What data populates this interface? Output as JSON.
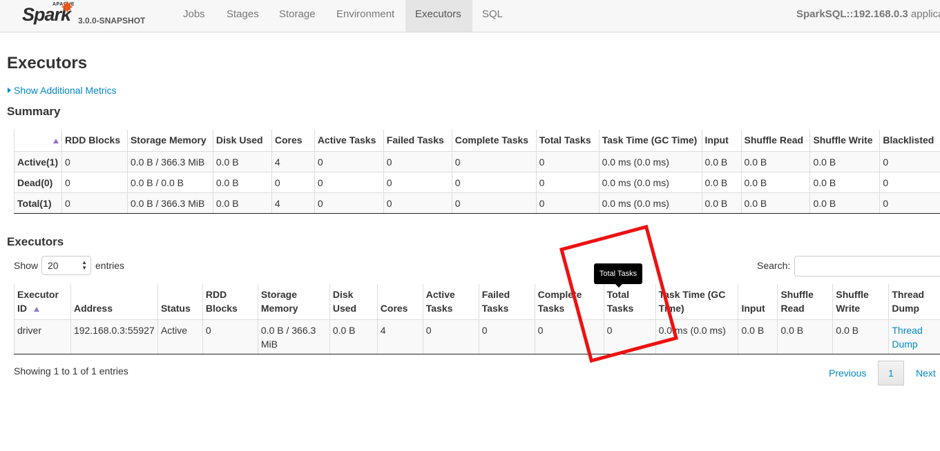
{
  "navbar": {
    "logo_small": "APACHE",
    "logo": "Spark",
    "version": "3.0.0-SNAPSHOT",
    "tabs": [
      {
        "label": "Jobs"
      },
      {
        "label": "Stages"
      },
      {
        "label": "Storage"
      },
      {
        "label": "Environment"
      },
      {
        "label": "Executors",
        "active": true
      },
      {
        "label": "SQL"
      }
    ],
    "app_title_bold": "SparkSQL::192.168.0.3",
    "app_title_rest": " applica"
  },
  "page_title": "Executors",
  "metrics_link": "Show Additional Metrics",
  "summary": {
    "title": "Summary",
    "columns": [
      "",
      "RDD Blocks",
      "Storage Memory",
      "Disk Used",
      "Cores",
      "Active Tasks",
      "Failed Tasks",
      "Complete Tasks",
      "Total Tasks",
      "Task Time (GC Time)",
      "Input",
      "Shuffle Read",
      "Shuffle Write",
      "Blacklisted"
    ],
    "rows": [
      [
        "Active(1)",
        "0",
        "0.0 B / 366.3 MiB",
        "0.0 B",
        "4",
        "0",
        "0",
        "0",
        "0",
        "0.0 ms (0.0 ms)",
        "0.0 B",
        "0.0 B",
        "0.0 B",
        "0"
      ],
      [
        "Dead(0)",
        "0",
        "0.0 B / 0.0 B",
        "0.0 B",
        "0",
        "0",
        "0",
        "0",
        "0",
        "0.0 ms (0.0 ms)",
        "0.0 B",
        "0.0 B",
        "0.0 B",
        "0"
      ],
      [
        "Total(1)",
        "0",
        "0.0 B / 366.3 MiB",
        "0.0 B",
        "4",
        "0",
        "0",
        "0",
        "0",
        "0.0 ms (0.0 ms)",
        "0.0 B",
        "0.0 B",
        "0.0 B",
        "0"
      ]
    ]
  },
  "executors": {
    "title": "Executors",
    "show_label": "Show",
    "page_size": "20",
    "entries_label": "entries",
    "search_label": "Search:",
    "columns": [
      "Executor ID",
      "Address",
      "Status",
      "RDD Blocks",
      "Storage Memory",
      "Disk Used",
      "Cores",
      "Active Tasks",
      "Failed Tasks",
      "Complete Tasks",
      "Total Tasks",
      "Task Time (GC Time)",
      "Input",
      "Shuffle Read",
      "Shuffle Write",
      "Thread Dump"
    ],
    "rows": [
      [
        "driver",
        "192.168.0.3:55927",
        "Active",
        "0",
        "0.0 B / 366.3 MiB",
        "0.0 B",
        "4",
        "0",
        "0",
        "0",
        "0",
        "0.0 ms (0.0 ms)",
        "0.0 B",
        "0.0 B",
        "0.0 B",
        "Thread Dump"
      ]
    ],
    "showing": "Showing 1 to 1 of 1 entries",
    "pagination": {
      "previous": "Previous",
      "current": "1",
      "next": "Next"
    }
  },
  "tooltip": "Total Tasks",
  "colors": {
    "link": "#0088cc",
    "annotation": "#ee1111",
    "sort_arrow": "#8f72d6"
  }
}
